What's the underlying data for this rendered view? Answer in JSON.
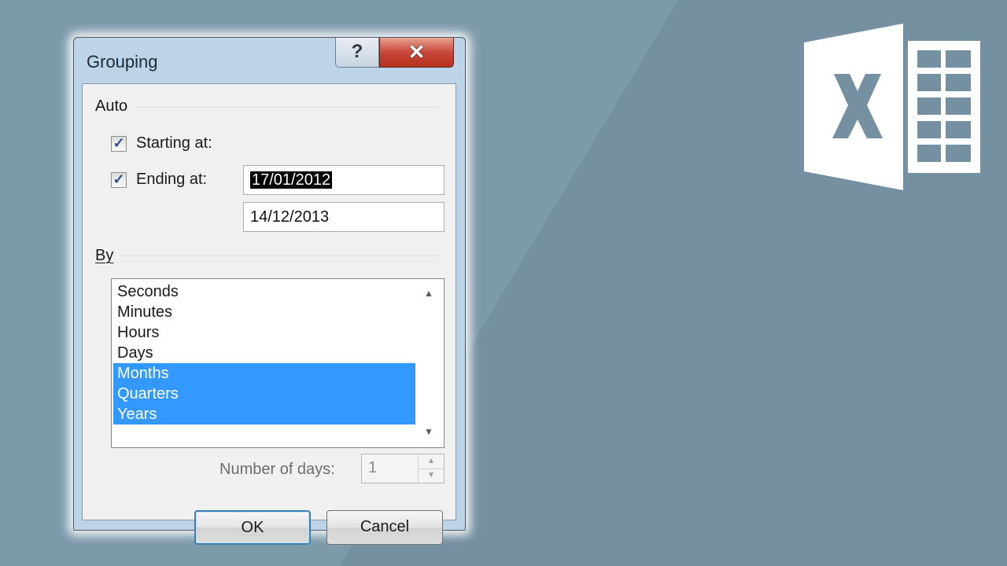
{
  "dialog": {
    "title": "Grouping",
    "help_glyph": "?",
    "close_glyph": "✕",
    "auto_group": {
      "label": "Auto",
      "starting": {
        "checked": true,
        "label": "Starting at:",
        "value": "17/01/2012"
      },
      "ending": {
        "checked": true,
        "label": "Ending at:",
        "value": "14/12/2013"
      }
    },
    "by_group": {
      "label": "By",
      "items": [
        {
          "label": "Seconds",
          "selected": false
        },
        {
          "label": "Minutes",
          "selected": false
        },
        {
          "label": "Hours",
          "selected": false
        },
        {
          "label": "Days",
          "selected": false
        },
        {
          "label": "Months",
          "selected": true
        },
        {
          "label": "Quarters",
          "selected": true
        },
        {
          "label": "Years",
          "selected": true
        }
      ]
    },
    "number_of_days": {
      "label": "Number of days:",
      "value": "1",
      "enabled": false
    },
    "buttons": {
      "ok": "OK",
      "cancel": "Cancel"
    }
  },
  "check_glyph": "✓",
  "icons": {
    "scroll_up": "scroll-up-arrow-icon",
    "scroll_down": "scroll-down-arrow-icon",
    "logo": "excel-logo-icon"
  },
  "colors": {
    "background": "#7590a0",
    "selection": "#3399ff",
    "close_button": "#c8473a"
  }
}
